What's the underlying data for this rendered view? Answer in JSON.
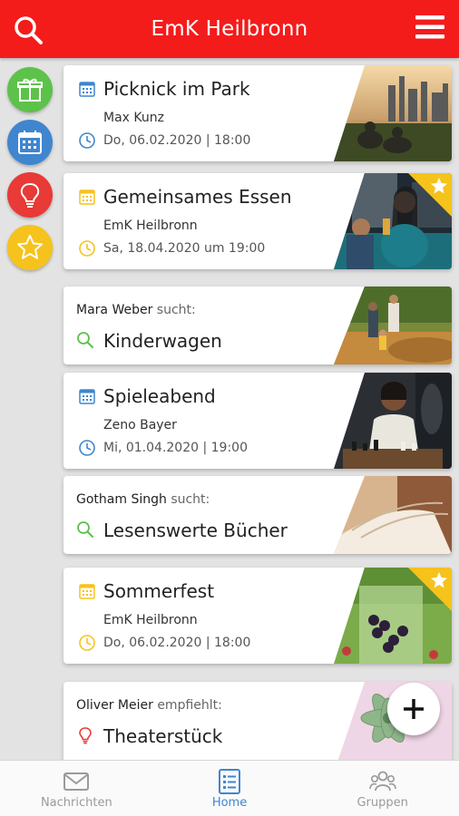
{
  "header": {
    "title": "EmK Heilbronn"
  },
  "colors": {
    "header_red": "#f41b1b",
    "gift_green": "#5cc24a",
    "calendar_blue": "#3f86cf",
    "idea_red": "#e83a36",
    "star_yellow": "#f6c21c",
    "active_nav": "#3f86cf"
  },
  "side_buttons": [
    {
      "icon": "gift-icon"
    },
    {
      "icon": "calendar-icon"
    },
    {
      "icon": "lightbulb-icon"
    },
    {
      "icon": "star-icon"
    }
  ],
  "cards": [
    {
      "type": "event",
      "title": "Picknick im Park",
      "organizer": "Max Kunz",
      "date": "Do, 06.02.2020 | 18:00",
      "icon_color": "#3f86cf",
      "starred": false
    },
    {
      "type": "event",
      "title": "Gemeinsames Essen",
      "organizer": "EmK Heilbronn",
      "date": "Sa, 18.04.2020 um 19:00",
      "icon_color": "#f6c21c",
      "starred": true
    },
    {
      "type": "request",
      "user": "Mara Weber",
      "verb": "sucht:",
      "title": "Kinderwagen"
    },
    {
      "type": "event",
      "title": "Spieleabend",
      "organizer": "Zeno Bayer",
      "date": "Mi, 01.04.2020 | 19:00",
      "icon_color": "#3f86cf",
      "starred": false
    },
    {
      "type": "request",
      "user": "Gotham Singh",
      "verb": "sucht:",
      "title": "Lesenswerte Bücher"
    },
    {
      "type": "event",
      "title": "Sommerfest",
      "organizer": "EmK Heilbronn",
      "date": "Do, 06.02.2020 | 18:00",
      "icon_color": "#f6c21c",
      "starred": true
    },
    {
      "type": "recommendation",
      "user": "Oliver Meier",
      "verb": "empfiehlt:",
      "title": "Theaterstück"
    }
  ],
  "bottom_nav": [
    {
      "label": "Nachrichten",
      "icon": "mail-icon",
      "active": false
    },
    {
      "label": "Home",
      "icon": "list-icon",
      "active": true
    },
    {
      "label": "Gruppen",
      "icon": "group-icon",
      "active": false
    }
  ]
}
